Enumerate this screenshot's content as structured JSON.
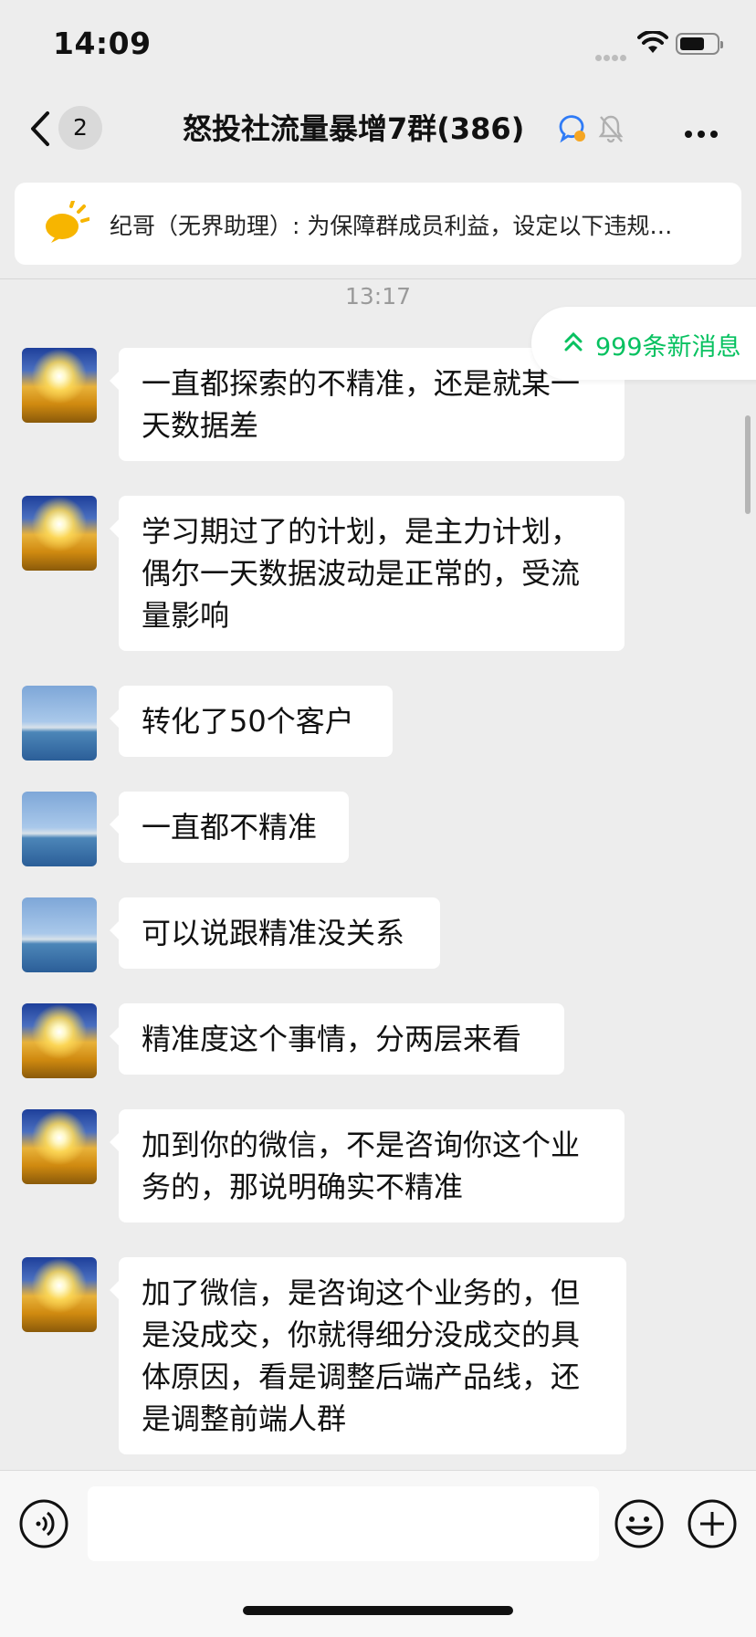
{
  "status": {
    "time": "14:09",
    "battery_level": 0.6
  },
  "header": {
    "back_count": "2",
    "title": "怒投社流量暴增7群(386)"
  },
  "announcement": {
    "text": "纪哥（无界助理）: 为保障群成员利益，设定以下违规…"
  },
  "timestamp": "13:17",
  "new_messages": {
    "label": "999条新消息"
  },
  "messages": [
    {
      "avatar": "sunrise-avatar",
      "text": "一直都探索的不精准，还是就某一天数据差"
    },
    {
      "avatar": "sunrise-avatar",
      "text": "学习期过了的计划，是主力计划，偶尔一天数据波动是正常的，受流量影响"
    },
    {
      "avatar": "sea-avatar",
      "text": "转化了50个客户"
    },
    {
      "avatar": "sea-avatar",
      "text": "一直都不精准"
    },
    {
      "avatar": "sea-avatar",
      "text": "可以说跟精准没关系"
    },
    {
      "avatar": "sunrise-avatar",
      "text": "精准度这个事情，分两层来看"
    },
    {
      "avatar": "sunrise-avatar",
      "text": "加到你的微信，不是咨询你这个业务的，那说明确实不精准"
    },
    {
      "avatar": "sunrise-avatar",
      "text": "加了微信，是咨询这个业务的，但是没成交，你就得细分没成交的具体原因，看是调整后端产品线，还是调整前端人群"
    }
  ],
  "input": {
    "value": ""
  }
}
